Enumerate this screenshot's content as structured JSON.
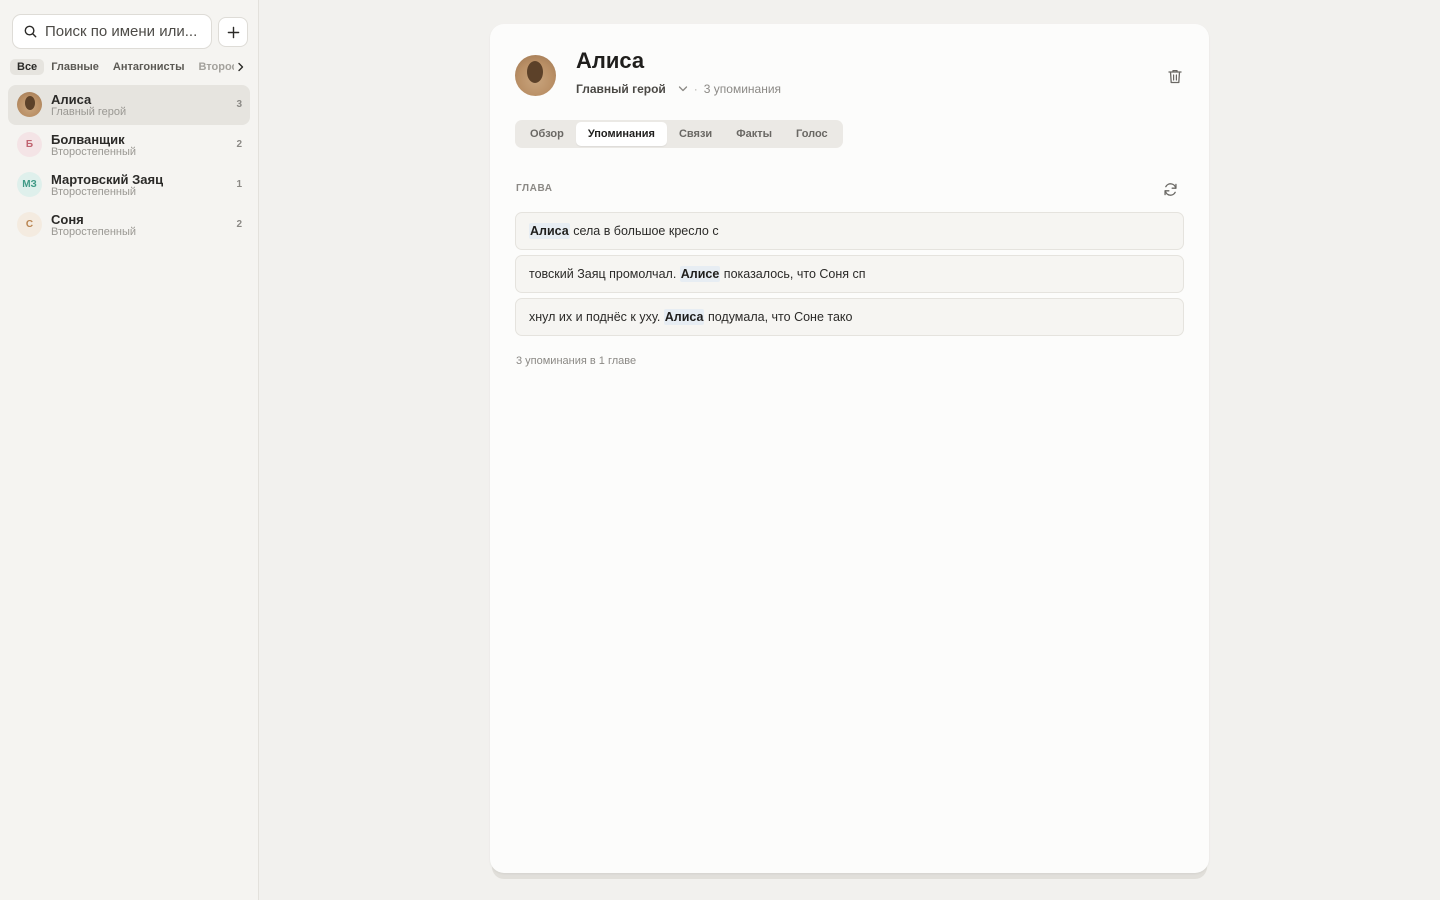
{
  "sidebar": {
    "search": {
      "placeholder": "Поиск по имени или..."
    },
    "filters": [
      "Все",
      "Главные",
      "Антагонисты",
      "Второстепенные"
    ],
    "characters": [
      {
        "name": "Алиса",
        "role": "Главный герой",
        "count": "3",
        "initials": "",
        "avatar_color": "#c9a57e"
      },
      {
        "name": "Болванщик",
        "role": "Второстепенный",
        "count": "2",
        "initials": "Б",
        "avatar_color": "#f4e4e6",
        "initials_color": "#c0636f"
      },
      {
        "name": "Мартовский Заяц",
        "role": "Второстепенный",
        "count": "1",
        "initials": "МЗ",
        "avatar_color": "#dff0ec",
        "initials_color": "#3f9a86"
      },
      {
        "name": "Соня",
        "role": "Второстепенный",
        "count": "2",
        "initials": "С",
        "avatar_color": "#f4ebe0",
        "initials_color": "#b98450"
      }
    ]
  },
  "detail": {
    "name": "Алиса",
    "role": "Главный герой",
    "mentions_count": "3 упоминания",
    "tabs": [
      "Обзор",
      "Упоминания",
      "Связи",
      "Факты",
      "Голос"
    ],
    "active_tab": "Упоминания",
    "section_label": "ГЛАВА",
    "mentions": [
      {
        "before": "",
        "highlight": "Алиса",
        "after": " села в большое кресло с"
      },
      {
        "before": "товский Заяц промолчал. ",
        "highlight": "Алисе",
        "after": " показалось, что Соня сп"
      },
      {
        "before": "хнул их и поднёс к уху. ",
        "highlight": "Алиса",
        "after": " подумала, что Соне тако"
      }
    ],
    "summary": "3 упоминания в 1 главе"
  },
  "icons": {
    "search": "search-icon",
    "add": "plus-icon",
    "filter_more": "chevron-right-icon",
    "role_dropdown": "chevron-down-icon",
    "delete": "trash-icon",
    "refresh": "refresh-icon"
  },
  "colors": {
    "background": "#f2f1ee",
    "card": "#fcfcfb",
    "highlight": "#e7edf3",
    "active_item": "#e6e4df"
  }
}
